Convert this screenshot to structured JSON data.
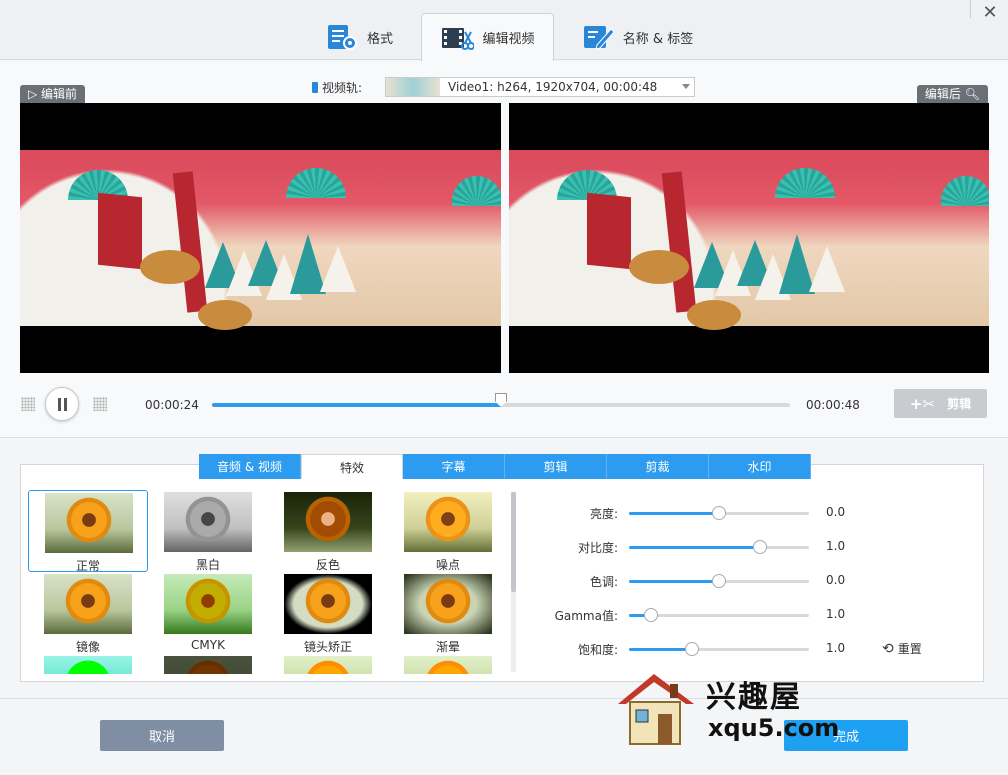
{
  "header": {
    "tabs": [
      {
        "label": "格式",
        "icon": "format-settings-icon",
        "active": false
      },
      {
        "label": "编辑视频",
        "icon": "video-edit-scissors-icon",
        "active": true
      },
      {
        "label": "名称 & 标签",
        "icon": "edit-pen-icon",
        "active": false
      }
    ],
    "close_glyph": "✕"
  },
  "preview": {
    "before_label": "编辑前",
    "after_label": "编辑后",
    "track_label": "视频轨:",
    "track_value": "Video1: h264, 1920x704, 00:00:48"
  },
  "transport": {
    "current_time": "00:00:24",
    "total_time": "00:00:48",
    "progress": 0.5,
    "cut_label": "剪辑"
  },
  "edit_tabs": [
    {
      "label": "音频 & 视频",
      "active": false
    },
    {
      "label": "特效",
      "active": true
    },
    {
      "label": "字幕",
      "active": false
    },
    {
      "label": "剪辑",
      "active": false
    },
    {
      "label": "剪裁",
      "active": false
    },
    {
      "label": "水印",
      "active": false
    }
  ],
  "effects": [
    {
      "label": "正常",
      "style": "normal",
      "selected": true
    },
    {
      "label": "黑白",
      "style": "bw"
    },
    {
      "label": "反色",
      "style": "inv"
    },
    {
      "label": "噪点",
      "style": "noise"
    },
    {
      "label": "镜像",
      "style": "normal"
    },
    {
      "label": "CMYK",
      "style": "cmyk"
    },
    {
      "label": "镜头矫正",
      "style": "lens"
    },
    {
      "label": "渐晕",
      "style": "vign"
    },
    {
      "label": "",
      "style": "green"
    },
    {
      "label": "",
      "style": "dark"
    },
    {
      "label": "",
      "style": "sun2"
    },
    {
      "label": "",
      "style": "sun2"
    }
  ],
  "adjustments": [
    {
      "label": "亮度:",
      "value": "0.0",
      "level": 0.5
    },
    {
      "label": "对比度:",
      "value": "1.0",
      "level": 0.73
    },
    {
      "label": "色调:",
      "value": "0.0",
      "level": 0.5
    },
    {
      "label": "Gamma值:",
      "value": "1.0",
      "level": 0.12
    },
    {
      "label": "饱和度:",
      "value": "1.0",
      "level": 0.35
    }
  ],
  "reset_label": "重置",
  "footer": {
    "cancel_label": "取消",
    "done_label": "完成"
  },
  "watermark": {
    "name": "兴趣屋",
    "url": "xqu5.com"
  },
  "colors": {
    "accent": "#2d9cf0",
    "cancel": "#7f8ea3",
    "done": "#1ea0f3"
  }
}
